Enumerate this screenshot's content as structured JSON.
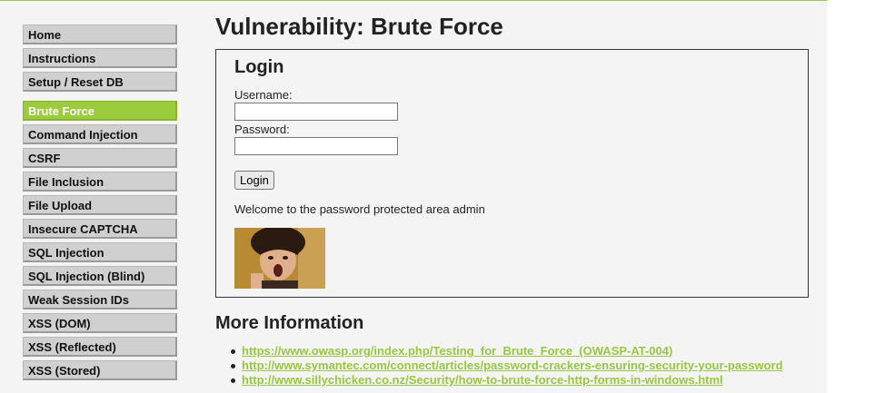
{
  "menu": {
    "group1": [
      "Home",
      "Instructions",
      "Setup / Reset DB"
    ],
    "group2": [
      "Brute Force",
      "Command Injection",
      "CSRF",
      "File Inclusion",
      "File Upload",
      "Insecure CAPTCHA",
      "SQL Injection",
      "SQL Injection (Blind)",
      "Weak Session IDs",
      "XSS (DOM)",
      "XSS (Reflected)",
      "XSS (Stored)"
    ],
    "active": "Brute Force"
  },
  "page": {
    "title": "Vulnerability: Brute Force"
  },
  "login_form": {
    "heading": "Login",
    "username_label": "Username:",
    "username_value": "",
    "password_label": "Password:",
    "password_value": "",
    "submit_label": "Login",
    "welcome_message": "Welcome to the password protected area admin"
  },
  "more_info": {
    "heading": "More Information",
    "links": [
      "https://www.owasp.org/index.php/Testing_for_Brute_Force_(OWASP-AT-004)",
      "http://www.symantec.com/connect/articles/password-crackers-ensuring-security-your-password",
      "http://www.sillychicken.co.nz/Security/how-to-brute-force-http-forms-in-windows.html"
    ]
  },
  "colors": {
    "accent": "#97c843",
    "active_menu": "#9ccc3d",
    "menu_bg": "#d0d0d0",
    "page_bg": "#f4f4f4"
  }
}
